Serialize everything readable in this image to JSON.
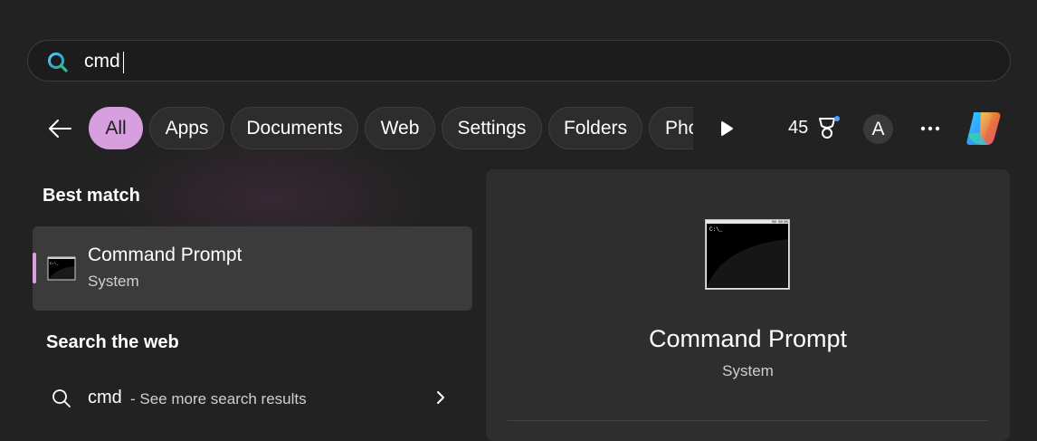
{
  "search": {
    "value": "cmd",
    "placeholder": ""
  },
  "filters": [
    {
      "label": "All",
      "active": true
    },
    {
      "label": "Apps"
    },
    {
      "label": "Documents"
    },
    {
      "label": "Web"
    },
    {
      "label": "Settings"
    },
    {
      "label": "Folders"
    },
    {
      "label": "Pho"
    }
  ],
  "header": {
    "points": "45",
    "avatar_initial": "A"
  },
  "icons": {
    "back": "arrow-left-icon",
    "play": "play-icon",
    "trophy": "trophy-icon",
    "more": "more-icon",
    "copilot": "copilot-icon",
    "search": "search-icon",
    "chevron": "chevron-right-icon",
    "cmd": "command-prompt-icon"
  },
  "best_match": {
    "section_title": "Best match",
    "title": "Command Prompt",
    "subtitle": "System"
  },
  "web": {
    "section_title": "Search the web",
    "query": "cmd",
    "hint": "- See more search results"
  },
  "preview": {
    "title": "Command Prompt",
    "subtitle": "System"
  },
  "colors": {
    "accent": "#d79fdd",
    "background": "#222222",
    "surface": "#2e2e2e"
  }
}
